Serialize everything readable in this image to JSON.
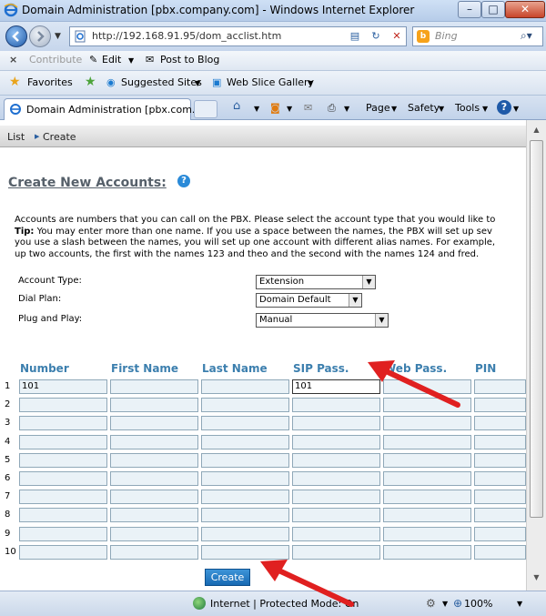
{
  "window": {
    "title": "Domain Administration [pbx.company.com] - Windows Internet Explorer",
    "minimize": "–",
    "maximize": "□",
    "close": "✕"
  },
  "address": {
    "url": "http://192.168.91.95/dom_acclist.htm",
    "search_placeholder": "Bing"
  },
  "command_bar": {
    "close_glyph": "×",
    "contribute": "Contribute",
    "edit": "Edit",
    "post_to_blog": "Post to Blog"
  },
  "favorites_bar": {
    "favorites": "Favorites",
    "suggested_sites": "Suggested Sites",
    "web_slice_gallery": "Web Slice Gallery"
  },
  "tab": {
    "title": "Domain Administration [pbx.com..."
  },
  "tools": {
    "page": "Page",
    "safety": "Safety",
    "tools": "Tools"
  },
  "subnav": {
    "list": "List",
    "create": "Create"
  },
  "page": {
    "heading": "Create New Accounts:",
    "desc_line1": "Accounts are numbers that you can call on the PBX. Please select the account type that you would like to",
    "tip_label": "Tip:",
    "desc_line2": " You may enter more than one name. If you use a space between the names, the PBX will set up sev",
    "desc_line3": "you use a slash between the names, you will set up one account with different alias names. For example,",
    "desc_line4": "up two accounts, the first with the names 123 and theo and the second with the names 124 and fred."
  },
  "form": {
    "account_type_label": "Account Type:",
    "account_type_value": "Extension",
    "dial_plan_label": "Dial Plan:",
    "dial_plan_value": "Domain Default",
    "plug_and_play_label": "Plug and Play:",
    "plug_and_play_value": "Manual"
  },
  "table": {
    "columns": [
      "Number",
      "First Name",
      "Last Name",
      "SIP Pass.",
      "Web Pass.",
      "PIN"
    ],
    "rows": [
      {
        "index": "1",
        "number": "101",
        "sip": "101"
      },
      {
        "index": "2",
        "number": "",
        "sip": ""
      },
      {
        "index": "3",
        "number": "",
        "sip": ""
      },
      {
        "index": "4",
        "number": "",
        "sip": ""
      },
      {
        "index": "5",
        "number": "",
        "sip": ""
      },
      {
        "index": "6",
        "number": "",
        "sip": ""
      },
      {
        "index": "7",
        "number": "",
        "sip": ""
      },
      {
        "index": "8",
        "number": "",
        "sip": ""
      },
      {
        "index": "9",
        "number": "",
        "sip": ""
      },
      {
        "index": "10",
        "number": "",
        "sip": ""
      }
    ]
  },
  "create_button": "Create",
  "status": {
    "zone": "Internet | Protected Mode: On",
    "zoom": "100%"
  },
  "colors": {
    "annotation_arrow": "#e02020",
    "column_header": "#3c7fae",
    "create_button": "#1769b3"
  }
}
